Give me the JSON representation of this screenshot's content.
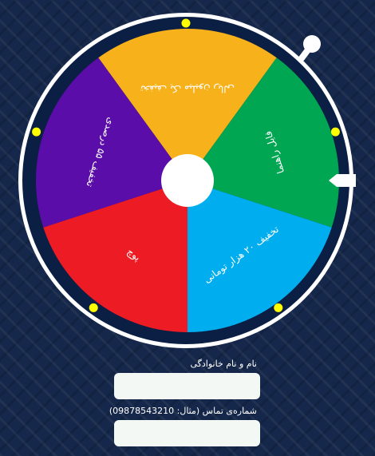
{
  "wheel": {
    "segments": [
      {
        "label": "تخفیف یک میلیون ریالی",
        "color": "#f7b11b"
      },
      {
        "label": "فایل راهنما",
        "color": "#00a651"
      },
      {
        "label": "تخفیف ۲۰ هزار تومانی",
        "color": "#00aeef"
      },
      {
        "label": "پوچ",
        "color": "#ed1c24"
      },
      {
        "label": "تخفیف ۵۵ درصدی",
        "color": "#5a0da8"
      }
    ],
    "rim_color": "#0b1e44",
    "border_color": "#ffffff",
    "light_color": "#ffff00",
    "hub_color": "#ffffff"
  },
  "form": {
    "name_label": "نام و نام خانوادگی",
    "name_value": "",
    "phone_label": "شماره‌ی تماس (مثال: 09878543210)",
    "phone_value": ""
  }
}
